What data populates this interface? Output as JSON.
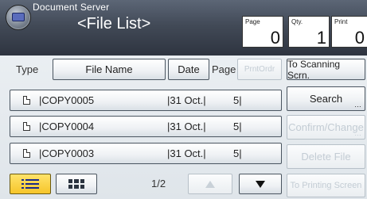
{
  "header": {
    "app_title": "Document Server",
    "screen_title": "<File List>",
    "page_label": "Page",
    "page_value": "0",
    "qty_label": "Qty.",
    "qty_value": "1",
    "print_label": "Print",
    "print_value": "0"
  },
  "columns": {
    "type": "Type",
    "file_name": "File Name",
    "date": "Date",
    "page": "Page",
    "print_order": "PrntOrdr"
  },
  "files": [
    {
      "name": "|COPY0005",
      "date": "|31 Oct.|",
      "pages": "5|"
    },
    {
      "name": "|COPY0004",
      "date": "|31 Oct.|",
      "pages": "5|"
    },
    {
      "name": "|COPY0003",
      "date": "|31 Oct.|",
      "pages": "5|"
    }
  ],
  "actions": {
    "to_scanning": "To Scanning Scrn.",
    "search": "Search",
    "confirm_change": "Confirm/Change",
    "delete_file": "Delete File",
    "to_printing": "To Printing Screen"
  },
  "pager": {
    "indicator": "1/2"
  },
  "icons": {
    "logo": "document-server-logo-icon",
    "list_view": "list-view-icon",
    "grid_view": "grid-view-icon",
    "doc": "document-icon",
    "up": "triangle-up-icon",
    "down": "triangle-down-icon"
  },
  "colors": {
    "header_bg": "#424a57",
    "active_view": "#f6c52a",
    "disabled_text": "#c3ccd4"
  }
}
